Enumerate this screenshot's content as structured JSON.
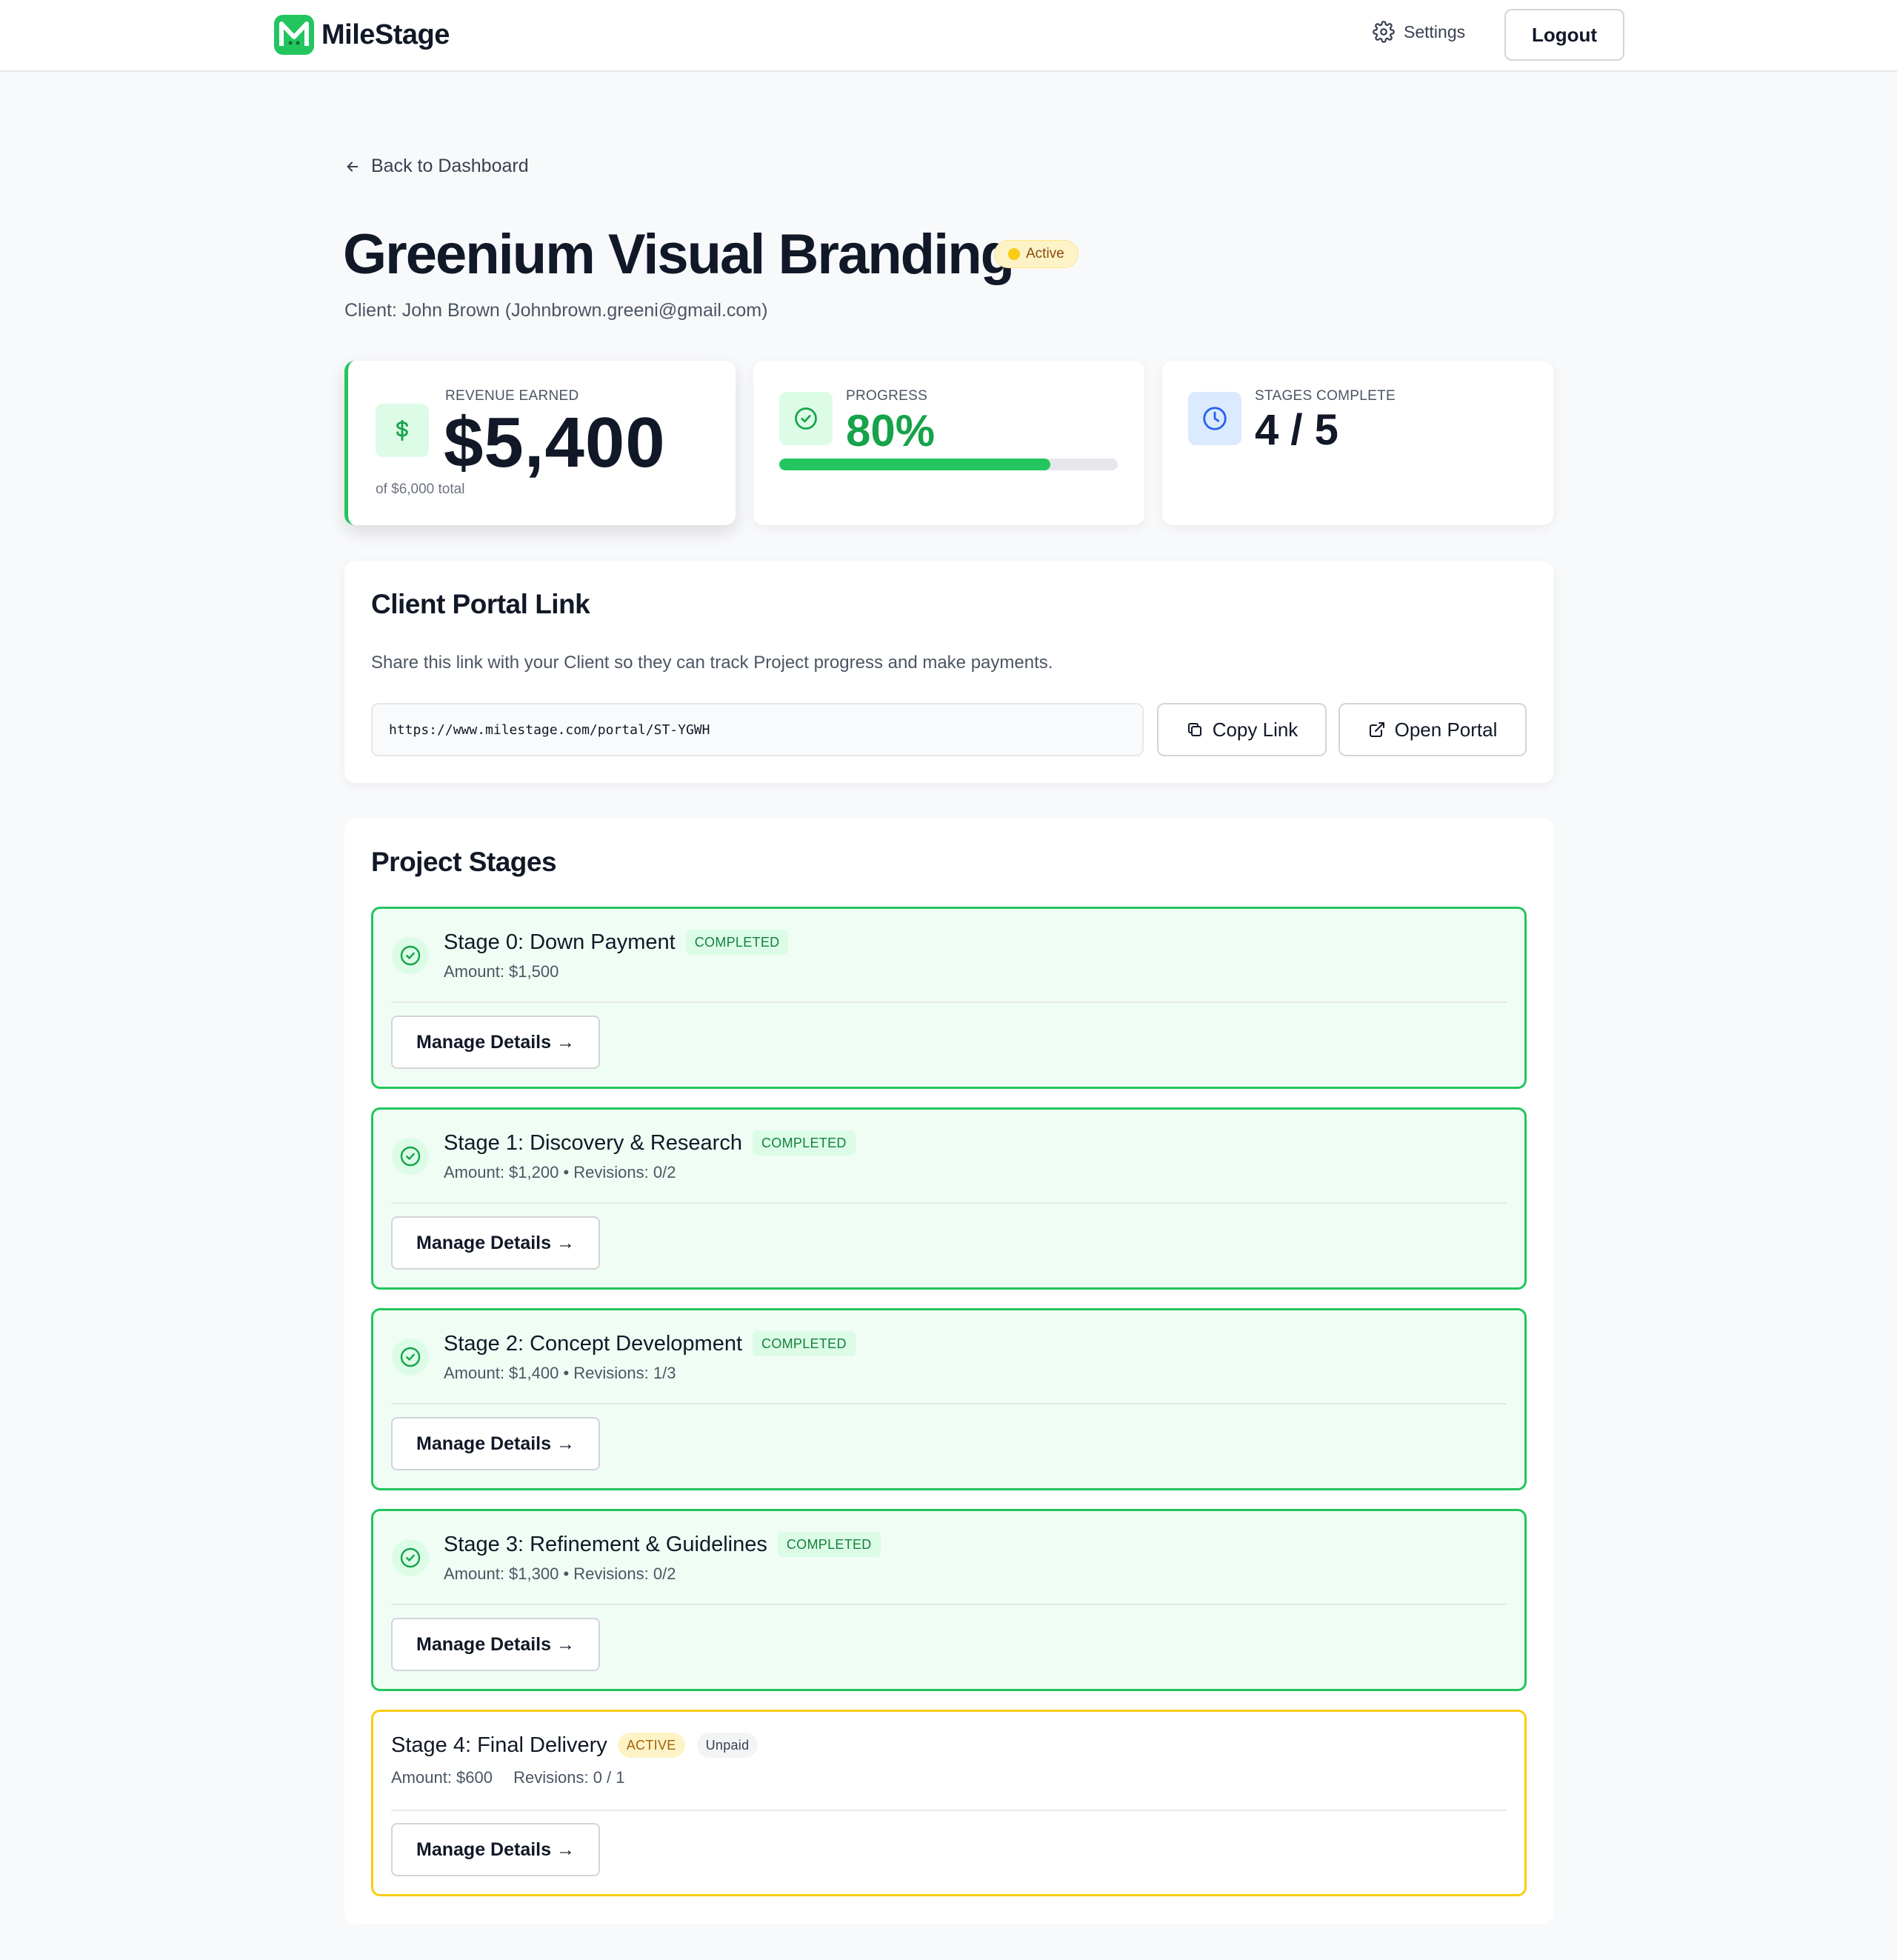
{
  "brand": {
    "name": "MileStage",
    "accent": "#22c55e"
  },
  "nav": {
    "settings_label": "Settings",
    "logout_label": "Logout"
  },
  "back_link": "Back to Dashboard",
  "project": {
    "title": "Greenium Visual Branding",
    "status": "Active",
    "client_line": "Client: John Brown (Johnbrown.greeni@gmail.com)"
  },
  "stats": {
    "revenue": {
      "label": "REVENUE EARNED",
      "value": "$5,400",
      "sub": "of $6,000 total"
    },
    "progress": {
      "label": "PROGRESS",
      "value": "80%",
      "fraction": 0.8
    },
    "stages": {
      "label": "STAGES COMPLETE",
      "value": "4 / 5"
    }
  },
  "portal": {
    "title": "Client Portal Link",
    "description": "Share this link with your Client so they can track Project progress and make payments.",
    "url": "https://www.milestage.com/portal/ST-YGWH",
    "copy_label": "Copy Link",
    "open_label": "Open Portal"
  },
  "stages_section": {
    "title": "Project Stages",
    "manage_label": "Manage Details →",
    "items": [
      {
        "name": "Stage 0: Down Payment",
        "status": "COMPLETED",
        "amount": "Amount: $1,500",
        "revisions": ""
      },
      {
        "name": "Stage 1: Discovery & Research",
        "status": "COMPLETED",
        "amount": "Amount: $1,200",
        "revisions": "• Revisions: 0/2"
      },
      {
        "name": "Stage 2: Concept Development",
        "status": "COMPLETED",
        "amount": "Amount: $1,400",
        "revisions": "• Revisions: 1/3"
      },
      {
        "name": "Stage 3: Refinement & Guidelines",
        "status": "COMPLETED",
        "amount": "Amount: $1,300",
        "revisions": "• Revisions: 0/2"
      },
      {
        "name": "Stage 4: Final Delivery",
        "status": "ACTIVE",
        "payment": "Unpaid",
        "amount": "Amount: $600",
        "revisions": "Revisions: 0 / 1"
      }
    ]
  }
}
